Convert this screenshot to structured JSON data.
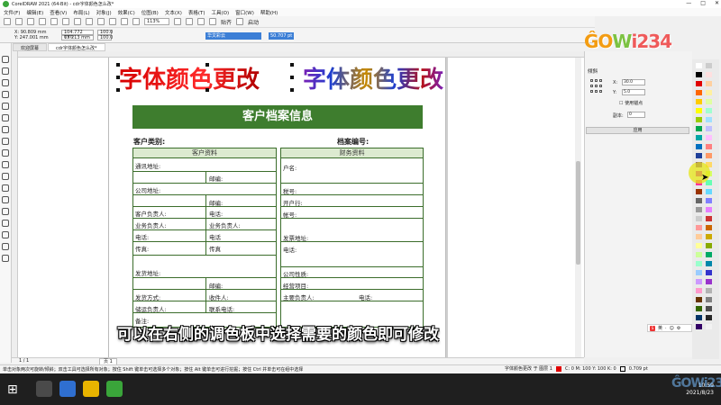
{
  "window": {
    "title": "CorelDRAW 2021 (64-Bit) - cdr字体颜色怎么改*",
    "controls": [
      "—",
      "□",
      "✕"
    ]
  },
  "menu": [
    "文件(F)",
    "编辑(E)",
    "查看(V)",
    "布局(L)",
    "对象(J)",
    "效果(C)",
    "位图(B)",
    "文本(X)",
    "表格(T)",
    "工具(O)",
    "窗口(W)",
    "帮助(H)"
  ],
  "toolbar": {
    "zoom": "113%",
    "snap_label": "贴齐",
    "launch_label": "启动"
  },
  "propbar": {
    "x": "X: 90.809 mm",
    "y": "Y: 247.001 mm",
    "w": "104.772 mm",
    "h": "13.213 mm",
    "sx": "100.0",
    "sy": "100.0",
    "font": "华文彩云",
    "size": "50.707 pt"
  },
  "tabs": [
    "欢迎屏幕",
    "cdr字体颜色怎么改*"
  ],
  "canvas": {
    "text1": "字体颜色更改",
    "text2": "字体颜色更改"
  },
  "form": {
    "title": "客户档案信息",
    "customer_type": "客户类别:",
    "file_no": "档案编号:",
    "left_header": "客户资料",
    "right_header": "财务资料",
    "left_rows": [
      "通讯地址:",
      "邮编:",
      "公司地址:",
      "邮编:",
      "客户负责人:",
      "电话:",
      "业务负责人:",
      "业务负责人:",
      "电话:",
      "电话",
      "传真:",
      "传真",
      "发货地址:",
      "邮编:",
      "发货方式:",
      "收件人:",
      "储运负责人:",
      "联系电话:",
      "备注:"
    ],
    "right_rows": [
      "户名:",
      "税号:",
      "开户行:",
      "帐号:",
      "发票地址:",
      "电话:",
      "公司性质:",
      "经营项目:",
      "主要负责人:",
      "电话:"
    ]
  },
  "subtitle": "可以在右侧的调色板中选择需要的颜色即可修改",
  "right_panel": {
    "title": "倾斜",
    "x_label": "X:",
    "x_value": "30.0",
    "y_label": "Y:",
    "y_value": "5.0",
    "checkbox_label": "使用锚点",
    "copies_label": "副本:",
    "copies_value": "0",
    "apply": "应用"
  },
  "logo": {
    "text1": "ĜO",
    "text2": "W",
    "text3": "i234"
  },
  "palette_colors": [
    "#ffffff",
    "#000000",
    "#e00000",
    "#ff6600",
    "#ffcc00",
    "#ffff00",
    "#99cc00",
    "#00a650",
    "#00a6a6",
    "#0070c0",
    "#1f3f99",
    "#7030a0",
    "#cc00cc",
    "#ff3399",
    "#993300",
    "#666666",
    "#999999",
    "#cccccc",
    "#ff9999",
    "#ffcc99",
    "#ffff99",
    "#ccff99",
    "#99ffcc",
    "#99ccff",
    "#cc99ff",
    "#ff99cc",
    "#663300",
    "#336600",
    "#003366",
    "#330066"
  ],
  "palette_colors_b": [
    "#cccccc",
    "#ffe0e0",
    "#ffd0a0",
    "#fff0a0",
    "#e0ffa0",
    "#a0ffd0",
    "#a0e0ff",
    "#c0c0ff",
    "#ffc0ff",
    "#ff8080",
    "#ff9966",
    "#ffd966",
    "#d6ff66",
    "#66ffb3",
    "#66d9ff",
    "#8080ff",
    "#e680ff",
    "#cc3333",
    "#cc6600",
    "#ccaa00",
    "#88aa00",
    "#00aa66",
    "#0088aa",
    "#3333cc",
    "#9933cc",
    "#b3b3b3",
    "#808080",
    "#4d4d4d",
    "#262626",
    "#f2f2f2"
  ],
  "statusbar": {
    "hint": "单击对象两次可旋转/倾斜；双击工具可选择所有对象；按住 Shift 键单击可选择多个对象；按住 Alt 键单击可进行挖掘；按住 Ctrl 并单击可在组中选择",
    "object": "字体颜色更改 于 图层 1",
    "fill": "C: 0 M: 100 Y: 100 K: 0",
    "outline": "0.709 pt"
  },
  "page_tab": "页 1",
  "page_counter": "1 / 1",
  "tray": {
    "time": "10:59",
    "date": "2021/8/23"
  },
  "watermark": "ĜOWi234"
}
